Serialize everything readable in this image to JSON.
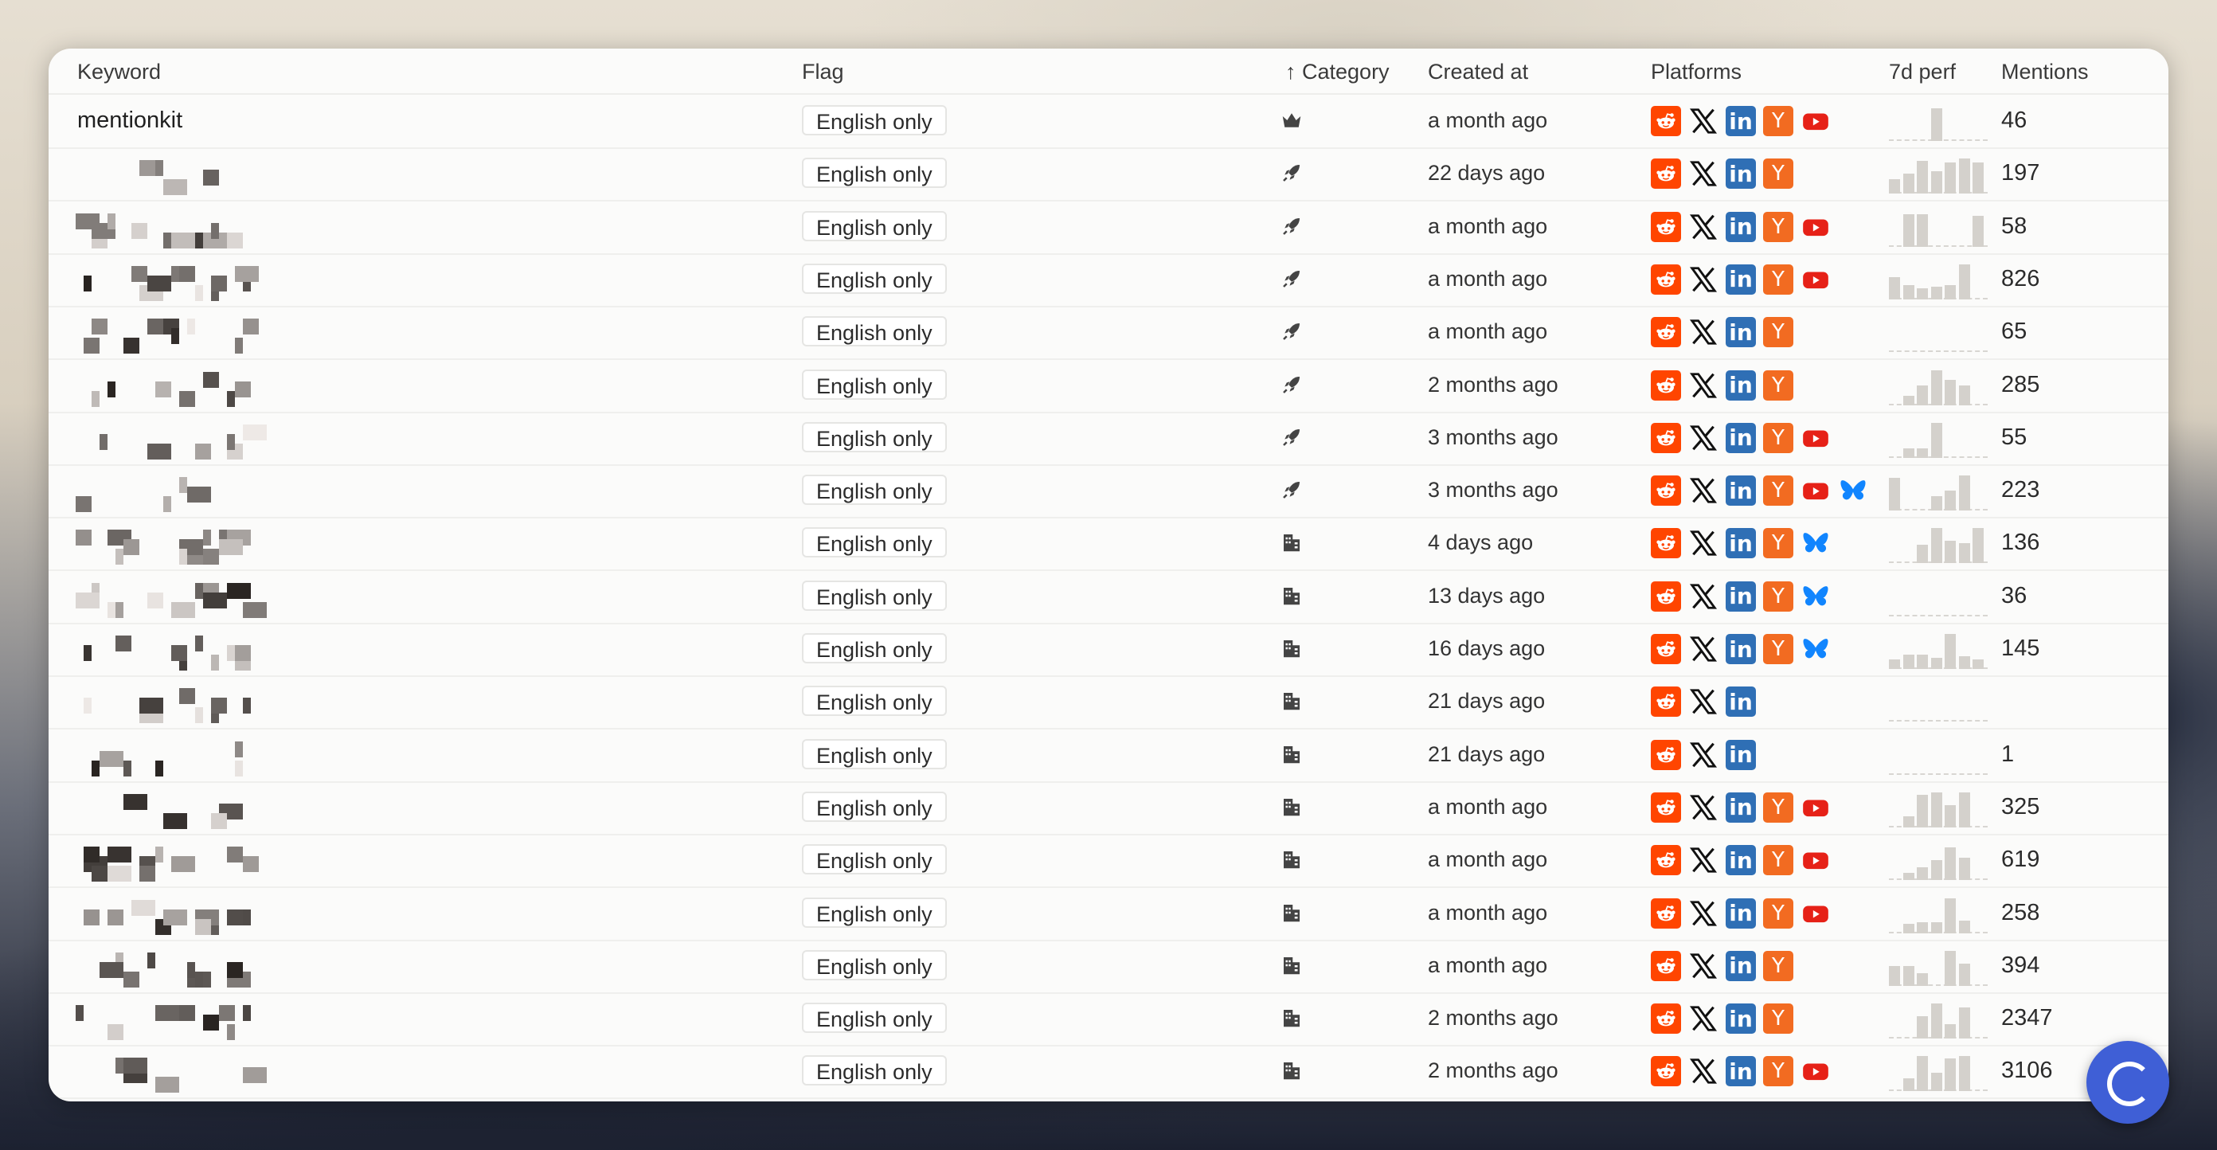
{
  "columns": {
    "keyword": "Keyword",
    "flag": "Flag",
    "category": "↑ Category",
    "created": "Created at",
    "platforms": "Platforms",
    "perf": "7d perf",
    "mentions": "Mentions"
  },
  "colors": {
    "reddit": "#ff4500",
    "linkedin": "#2f6fb5",
    "hackernews": "#f26b21",
    "youtube": "#e62117",
    "bluesky": "#1185fe",
    "spark": "#d4d1cc",
    "chat_button": "#3f5fd6"
  },
  "rows": [
    {
      "keyword": "mentionkit",
      "flag": "English only",
      "category_icon": "crown-icon",
      "created": "a month ago",
      "platforms": [
        "reddit",
        "x",
        "linkedin",
        "hackernews",
        "youtube"
      ],
      "perf": [
        0.1,
        0.1,
        0.1,
        0.9,
        0.1,
        0.1,
        0.1
      ],
      "mentions": "46"
    },
    {
      "keyword": "",
      "flag": "English only",
      "category_icon": "rocket-icon",
      "created": "22 days ago",
      "platforms": [
        "reddit",
        "x",
        "linkedin",
        "hackernews"
      ],
      "perf": [
        0.4,
        0.55,
        0.9,
        0.6,
        0.85,
        0.95,
        0.85
      ],
      "mentions": "197"
    },
    {
      "keyword": "",
      "flag": "English only",
      "category_icon": "rocket-icon",
      "created": "a month ago",
      "platforms": [
        "reddit",
        "x",
        "linkedin",
        "hackernews",
        "youtube"
      ],
      "perf": [
        0.1,
        0.9,
        0.9,
        0.1,
        0.1,
        0.1,
        0.85
      ],
      "mentions": "58"
    },
    {
      "keyword": "",
      "flag": "English only",
      "category_icon": "rocket-icon",
      "created": "a month ago",
      "platforms": [
        "reddit",
        "x",
        "linkedin",
        "hackernews",
        "youtube"
      ],
      "perf": [
        0.6,
        0.4,
        0.3,
        0.35,
        0.4,
        0.95,
        0.1
      ],
      "mentions": "826"
    },
    {
      "keyword": "",
      "flag": "English only",
      "category_icon": "rocket-icon",
      "created": "a month ago",
      "platforms": [
        "reddit",
        "x",
        "linkedin",
        "hackernews"
      ],
      "perf": [
        0,
        0,
        0,
        0,
        0,
        0,
        0
      ],
      "mentions": "65"
    },
    {
      "keyword": "",
      "flag": "English only",
      "category_icon": "rocket-icon",
      "created": "2 months ago",
      "platforms": [
        "reddit",
        "x",
        "linkedin",
        "hackernews"
      ],
      "perf": [
        0.1,
        0.25,
        0.55,
        0.95,
        0.7,
        0.55,
        0.1
      ],
      "mentions": "285"
    },
    {
      "keyword": "",
      "flag": "English only",
      "category_icon": "rocket-icon",
      "created": "3 months ago",
      "platforms": [
        "reddit",
        "x",
        "linkedin",
        "hackernews",
        "youtube"
      ],
      "perf": [
        0.1,
        0.25,
        0.25,
        0.95,
        0.1,
        0.1,
        0.1
      ],
      "mentions": "55"
    },
    {
      "keyword": "",
      "flag": "English only",
      "category_icon": "rocket-icon",
      "created": "3 months ago",
      "platforms": [
        "reddit",
        "x",
        "linkedin",
        "hackernews",
        "youtube",
        "bluesky"
      ],
      "perf": [
        0.9,
        0.1,
        0.1,
        0.4,
        0.55,
        0.95,
        0.1
      ],
      "mentions": "223"
    },
    {
      "keyword": "",
      "flag": "English only",
      "category_icon": "building-icon",
      "created": "4 days ago",
      "platforms": [
        "reddit",
        "x",
        "linkedin",
        "hackernews",
        "bluesky"
      ],
      "perf": [
        0.1,
        0.1,
        0.5,
        0.95,
        0.6,
        0.55,
        0.95
      ],
      "mentions": "136"
    },
    {
      "keyword": "",
      "flag": "English only",
      "category_icon": "building-icon",
      "created": "13 days ago",
      "platforms": [
        "reddit",
        "x",
        "linkedin",
        "hackernews",
        "bluesky"
      ],
      "perf": [
        0,
        0,
        0,
        0,
        0,
        0,
        0
      ],
      "mentions": "36"
    },
    {
      "keyword": "",
      "flag": "English only",
      "category_icon": "building-icon",
      "created": "16 days ago",
      "platforms": [
        "reddit",
        "x",
        "linkedin",
        "hackernews",
        "bluesky"
      ],
      "perf": [
        0.25,
        0.4,
        0.4,
        0.3,
        0.95,
        0.35,
        0.25
      ],
      "mentions": "145"
    },
    {
      "keyword": "",
      "flag": "English only",
      "category_icon": "building-icon",
      "created": "21 days ago",
      "platforms": [
        "reddit",
        "x",
        "linkedin"
      ],
      "perf": [
        0,
        0,
        0,
        0,
        0,
        0,
        0
      ],
      "mentions": ""
    },
    {
      "keyword": "",
      "flag": "English only",
      "category_icon": "building-icon",
      "created": "21 days ago",
      "platforms": [
        "reddit",
        "x",
        "linkedin"
      ],
      "perf": [
        0,
        0,
        0,
        0,
        0,
        0,
        0
      ],
      "mentions": "1"
    },
    {
      "keyword": "",
      "flag": "English only",
      "category_icon": "building-icon",
      "created": "a month ago",
      "platforms": [
        "reddit",
        "x",
        "linkedin",
        "hackernews",
        "youtube"
      ],
      "perf": [
        0.1,
        0.3,
        0.9,
        0.95,
        0.6,
        0.95,
        0.1
      ],
      "mentions": "325"
    },
    {
      "keyword": "",
      "flag": "English only",
      "category_icon": "building-icon",
      "created": "a month ago",
      "platforms": [
        "reddit",
        "x",
        "linkedin",
        "hackernews",
        "youtube"
      ],
      "perf": [
        0.1,
        0.2,
        0.35,
        0.55,
        0.9,
        0.6,
        0.1
      ],
      "mentions": "619"
    },
    {
      "keyword": "",
      "flag": "English only",
      "category_icon": "building-icon",
      "created": "a month ago",
      "platforms": [
        "reddit",
        "x",
        "linkedin",
        "hackernews",
        "youtube"
      ],
      "perf": [
        0.1,
        0.25,
        0.3,
        0.3,
        0.95,
        0.35,
        0.1
      ],
      "mentions": "258"
    },
    {
      "keyword": "",
      "flag": "English only",
      "category_icon": "building-icon",
      "created": "a month ago",
      "platforms": [
        "reddit",
        "x",
        "linkedin",
        "hackernews"
      ],
      "perf": [
        0.55,
        0.55,
        0.35,
        0.1,
        0.95,
        0.6,
        0.1
      ],
      "mentions": "394"
    },
    {
      "keyword": "",
      "flag": "English only",
      "category_icon": "building-icon",
      "created": "2 months ago",
      "platforms": [
        "reddit",
        "x",
        "linkedin",
        "hackernews"
      ],
      "perf": [
        0.1,
        0.1,
        0.6,
        0.95,
        0.4,
        0.85,
        0.1
      ],
      "mentions": "2347"
    },
    {
      "keyword": "",
      "flag": "English only",
      "category_icon": "building-icon",
      "created": "2 months ago",
      "platforms": [
        "reddit",
        "x",
        "linkedin",
        "hackernews",
        "youtube"
      ],
      "perf": [
        0.1,
        0.35,
        0.95,
        0.5,
        0.9,
        0.95,
        0.1
      ],
      "mentions": "3106"
    }
  ]
}
